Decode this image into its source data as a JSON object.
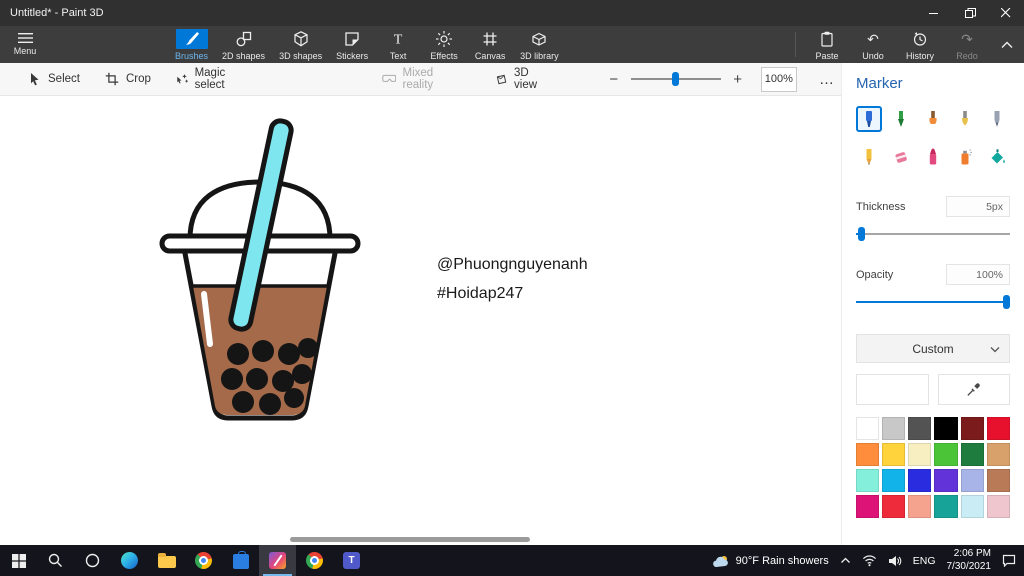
{
  "titlebar": {
    "title": "Untitled* - Paint 3D"
  },
  "ribbon": {
    "menu_label": "Menu",
    "tabs": [
      {
        "label": "Brushes",
        "active": true
      },
      {
        "label": "2D shapes"
      },
      {
        "label": "3D shapes"
      },
      {
        "label": "Stickers"
      },
      {
        "label": "Text"
      },
      {
        "label": "Effects"
      },
      {
        "label": "Canvas"
      },
      {
        "label": "3D library"
      }
    ],
    "actions": [
      {
        "label": "Paste"
      },
      {
        "label": "Undo"
      },
      {
        "label": "History"
      },
      {
        "label": "Redo",
        "disabled": true
      }
    ]
  },
  "toolbar": {
    "select": "Select",
    "crop": "Crop",
    "magic_select": "Magic select",
    "mixed_reality": "Mixed reality",
    "view_3d": "3D view",
    "zoom_out": "−",
    "zoom_in": "+",
    "zoom_value": "100%",
    "more": "…"
  },
  "canvas": {
    "text_line1": "@Phuongnguyenanh",
    "text_line2": "#Hoidap247"
  },
  "panel": {
    "title": "Marker",
    "brushes": [
      {
        "name": "Marker",
        "selected": true
      },
      {
        "name": "Calligraphy pen"
      },
      {
        "name": "Oil brush"
      },
      {
        "name": "Watercolor"
      },
      {
        "name": "Pixel pen"
      },
      {
        "name": "Pencil"
      },
      {
        "name": "Eraser"
      },
      {
        "name": "Crayon"
      },
      {
        "name": "Spray can"
      },
      {
        "name": "Fill"
      }
    ],
    "thickness_label": "Thickness",
    "thickness_value": "5px",
    "opacity_label": "Opacity",
    "opacity_value": "100%",
    "palette_select": "Custom",
    "current_color": "#ffffff",
    "colors": [
      "#ffffff",
      "#c8c8c8",
      "#535353",
      "#000000",
      "#7b1b1b",
      "#e8112d",
      "#ff8d3c",
      "#ffd33c",
      "#f7eec2",
      "#4cc437",
      "#1d7c3e",
      "#d8a06a",
      "#84f0dc",
      "#12b3e8",
      "#2a2ce0",
      "#6233d8",
      "#a8b4e8",
      "#b97a57",
      "#dd1378",
      "#ee2b3a",
      "#f5a38e",
      "#17a398",
      "#c9ecf5",
      "#efc5ce"
    ]
  },
  "taskbar": {
    "weather": "90°F Rain showers",
    "language": "ENG",
    "time": "2:06 PM",
    "date": "7/30/2021"
  }
}
